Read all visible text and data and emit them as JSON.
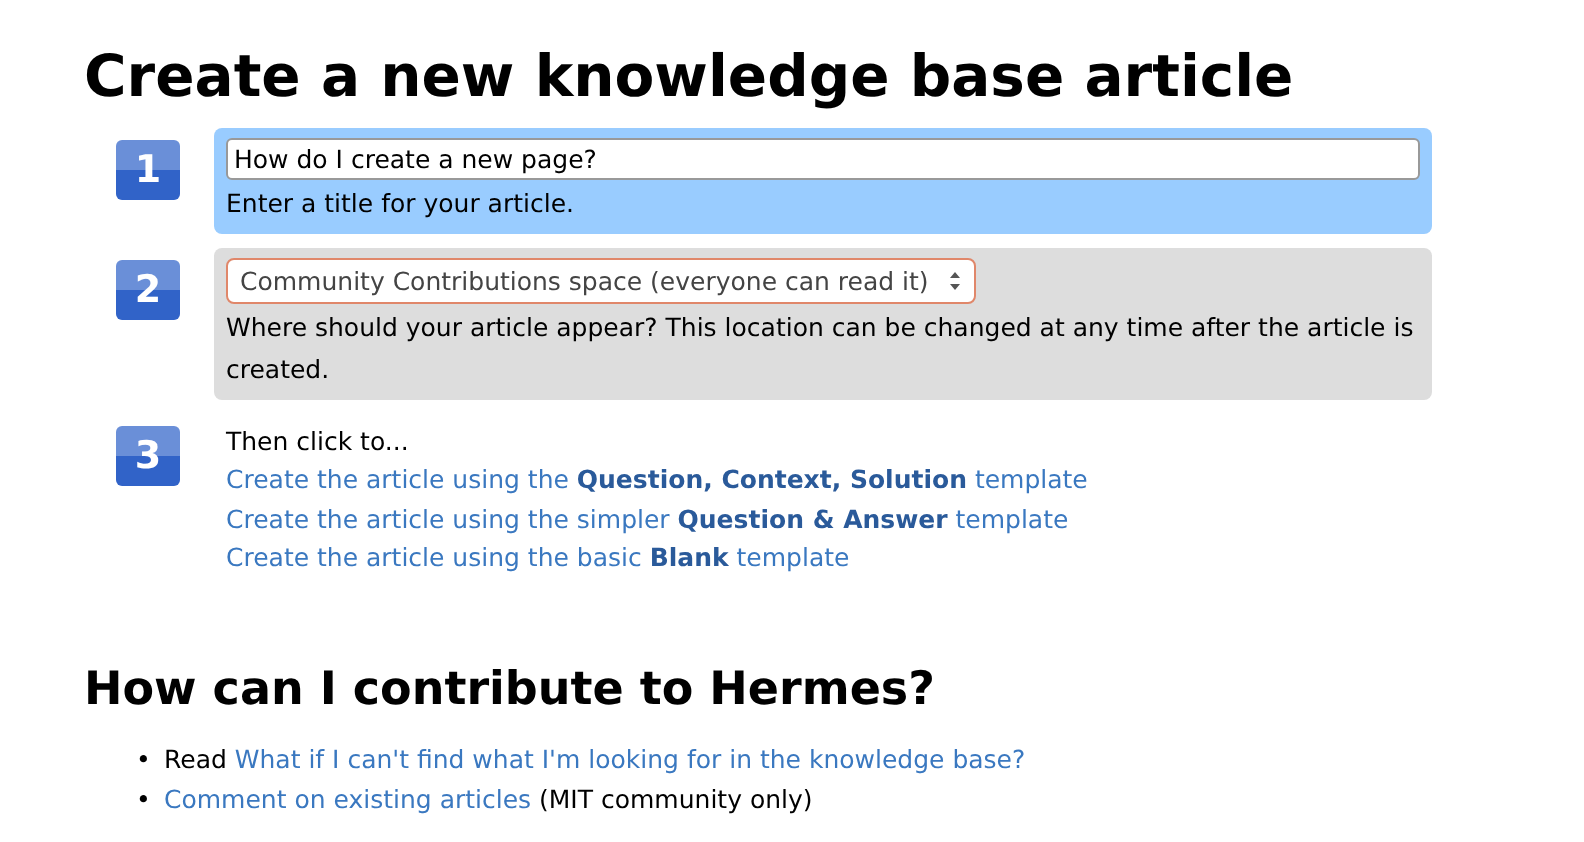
{
  "title": "Create a new knowledge base article",
  "steps": [
    {
      "number": "1",
      "kind": "input",
      "selected": true,
      "value": "How do I create a new page?",
      "hint": "Enter a title for your article."
    },
    {
      "number": "2",
      "kind": "select",
      "selected": false,
      "value": "Community Contributions space (everyone can read it)",
      "hint": "Where should your article appear? This location can be changed at any time after the article is created."
    },
    {
      "number": "3",
      "kind": "links",
      "intro": "Then click to...",
      "links": [
        "Create the article using the **Question, Context, Solution** template",
        "Create the article using the simpler **Question & Answer** template",
        "Create the article using the basic **Blank** template"
      ]
    }
  ],
  "contribute": {
    "title": "How can I contribute to Hermes?",
    "items": [
      {
        "bullet": "•",
        "before": "Read ",
        "link": "What if I can't find what I'm looking for in the knowledge base?"
      },
      {
        "bullet": "•",
        "link": "Comment on existing articles",
        "after": " (MIT community only)"
      }
    ]
  }
}
